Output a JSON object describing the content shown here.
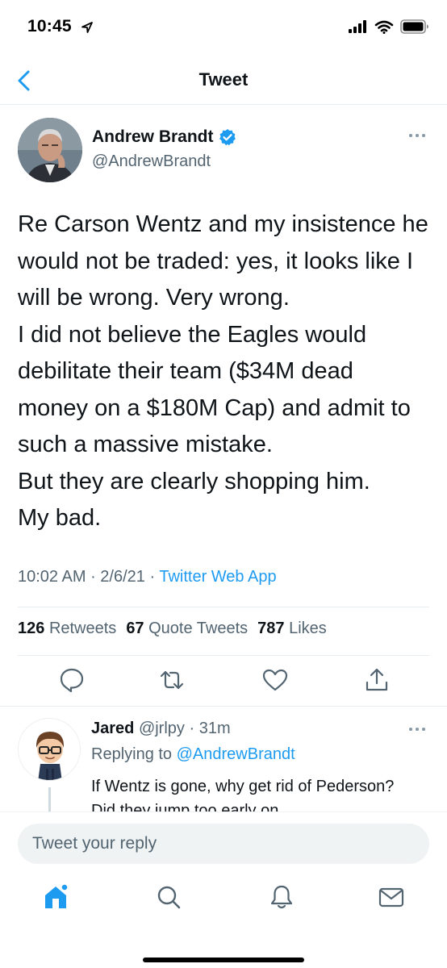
{
  "status_bar": {
    "time": "10:45"
  },
  "nav": {
    "title": "Tweet"
  },
  "tweet": {
    "author_name": "Andrew Brandt",
    "author_handle": "@AndrewBrandt",
    "text": "Re Carson Wentz and my insistence he would not be traded: yes, it looks like I will be wrong.  Very wrong.\nI did not believe the Eagles would debilitate their team ($34M dead money on a $180M Cap) and admit to such a massive mistake.\nBut they are clearly shopping him.\nMy bad.",
    "time": "10:02 AM",
    "date": "2/6/21",
    "source": "Twitter Web App",
    "retweets_count": "126",
    "retweets_label": "Retweets",
    "quotes_count": "67",
    "quotes_label": "Quote Tweets",
    "likes_count": "787",
    "likes_label": "Likes"
  },
  "reply": {
    "name": "Jared",
    "handle": "@jrlpy",
    "age": "31m",
    "replying_label": "Replying to",
    "replying_handle": "@AndrewBrandt",
    "text": "If Wentz is gone, why get rid of Pederson? Did they jump too early on"
  },
  "composer": {
    "placeholder": "Tweet your reply"
  },
  "colors": {
    "accent": "#1d9bf0",
    "secondary_text": "#536471",
    "primary_text": "#0f1419"
  },
  "icons": {
    "nav_back": "chevron-left-icon",
    "verified": "verified-badge-icon",
    "more": "more-horizontal-icon",
    "reply": "reply-icon",
    "retweet": "retweet-icon",
    "like": "heart-icon",
    "share": "share-icon",
    "home": "home-icon",
    "search": "search-icon",
    "notifications": "bell-icon",
    "messages": "mail-icon"
  }
}
